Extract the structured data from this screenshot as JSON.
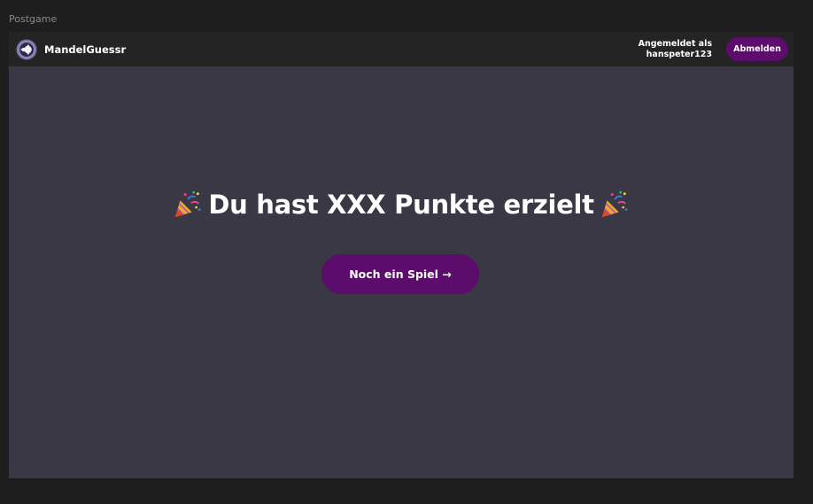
{
  "canvas": {
    "label": "Postgame"
  },
  "header": {
    "brand_name": "MandelGuessr",
    "logged_in_label": "Angemeldet als",
    "username": "hanspeter123",
    "logout_label": "Abmelden"
  },
  "main": {
    "headline": "Du hast XXX Punkte erzielt",
    "play_again_label": "Noch ein Spiel →",
    "icon_left": "party-popper-icon",
    "icon_right": "party-popper-icon"
  },
  "colors": {
    "accent": "#5c0c6b",
    "frame_bg": "#393844",
    "topbar_bg": "#242424",
    "canvas_bg": "#1e1e1e"
  }
}
